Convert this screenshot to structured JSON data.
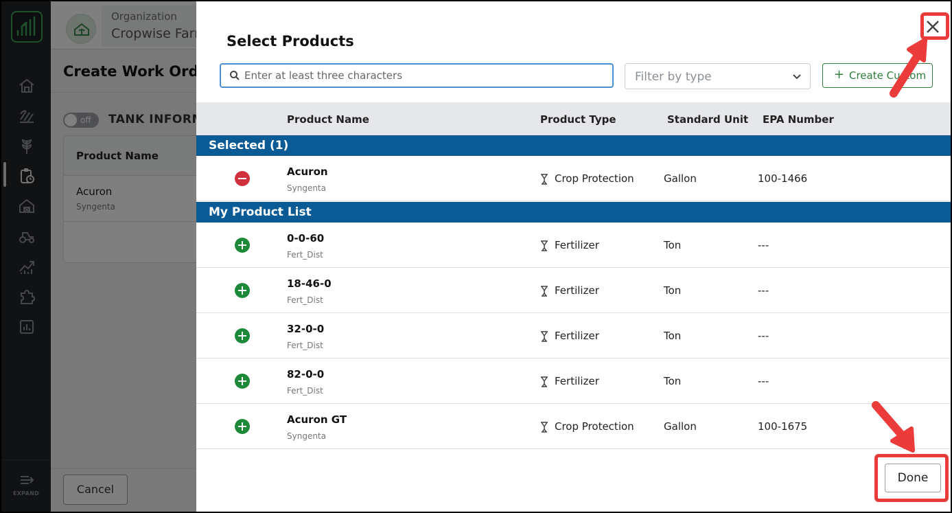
{
  "sidebar": {
    "expand_label": "EXPAND",
    "icons": [
      "home-icon",
      "field-icon",
      "crop-icon",
      "work-orders-icon",
      "farm-icon",
      "equipment-icon",
      "yield-icon",
      "integrations-icon",
      "reports-icon"
    ]
  },
  "background": {
    "org_label": "Organization",
    "org_name": "Cropwise Farm",
    "page_title": "Create Work Order",
    "toggle_text": "off",
    "tank_label": "TANK INFORMATION",
    "table_header": "Product Name",
    "product_name": "Acuron",
    "product_maker": "Syngenta",
    "cancel_label": "Cancel"
  },
  "modal": {
    "title": "Select Products",
    "search_placeholder": "Enter at least three characters",
    "filter_placeholder": "Filter by type",
    "create_label": "Create Custom",
    "columns": [
      "Product Name",
      "Product Type",
      "Standard Unit",
      "EPA Number"
    ],
    "selected_header": "Selected (1)",
    "list_header": "My Product List",
    "selected": [
      {
        "name": "Acuron",
        "maker": "Syngenta",
        "type": "Crop Protection",
        "unit": "Gallon",
        "epa": "100-1466"
      }
    ],
    "products": [
      {
        "name": "0-0-60",
        "maker": "Fert_Dist",
        "type": "Fertilizer",
        "unit": "Ton",
        "epa": "---"
      },
      {
        "name": "18-46-0",
        "maker": "Fert_Dist",
        "type": "Fertilizer",
        "unit": "Ton",
        "epa": "---"
      },
      {
        "name": "32-0-0",
        "maker": "Fert_Dist",
        "type": "Fertilizer",
        "unit": "Ton",
        "epa": "---"
      },
      {
        "name": "82-0-0",
        "maker": "Fert_Dist",
        "type": "Fertilizer",
        "unit": "Ton",
        "epa": "---"
      },
      {
        "name": "Acuron GT",
        "maker": "Syngenta",
        "type": "Crop Protection",
        "unit": "Gallon",
        "epa": "100-1675"
      }
    ],
    "done_label": "Done"
  },
  "colors": {
    "section_blue": "#0a5b95",
    "add_green": "#1d8a3a",
    "remove_red": "#d0303b",
    "annotation_red": "#ec3b3b"
  }
}
